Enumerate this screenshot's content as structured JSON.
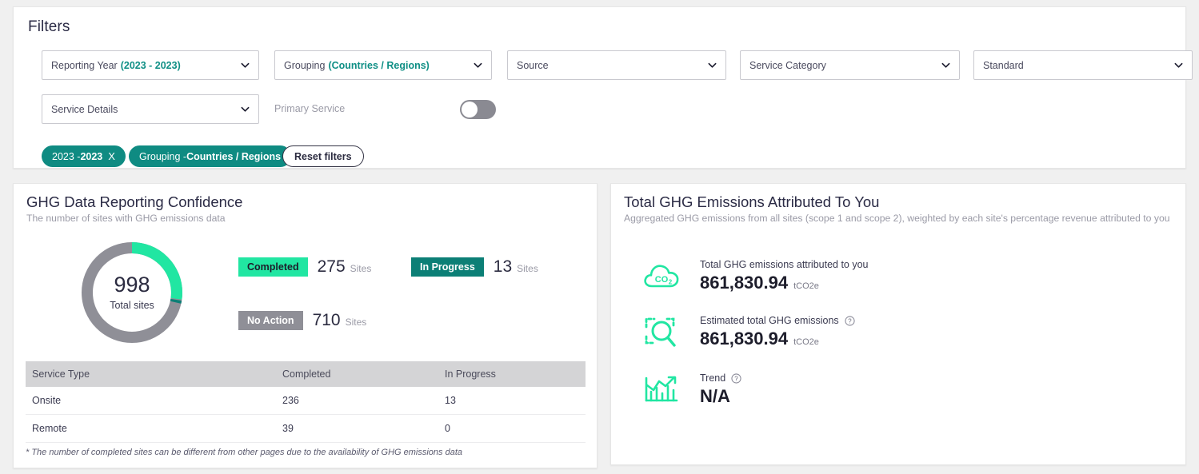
{
  "filters": {
    "title": "Filters",
    "selects": [
      {
        "label": "Reporting Year",
        "value": "(2023 - 2023)"
      },
      {
        "label": "Grouping",
        "value": "(Countries / Regions)"
      },
      {
        "label": "Source",
        "value": ""
      },
      {
        "label": "Service Category",
        "value": ""
      },
      {
        "label": "Standard",
        "value": ""
      },
      {
        "label": "Service Details",
        "value": ""
      }
    ],
    "primary_service_label": "Primary Service",
    "primary_service_on": false,
    "chips": [
      {
        "label": "2023  -  ",
        "strong": "2023",
        "close": "X"
      },
      {
        "label": "Grouping  -  ",
        "strong": "Countries / Regions",
        "close": ""
      }
    ],
    "reset_label": "Reset filters"
  },
  "confidence_panel": {
    "title": "GHG Data Reporting Confidence",
    "subtitle": "The number of sites with GHG emissions data",
    "donut": {
      "total": "998",
      "total_label": "Total sites"
    },
    "legend": [
      {
        "badge": "Completed",
        "count": "275",
        "unit": "Sites",
        "color": "#21e6a2"
      },
      {
        "badge": "In Progress",
        "count": "13",
        "unit": "Sites",
        "color": "#0c7f76"
      },
      {
        "badge": "No Action",
        "count": "710",
        "unit": "Sites",
        "color": "#8f8f97"
      }
    ],
    "table": {
      "headers": [
        "Service Type",
        "Completed",
        "In Progress"
      ],
      "rows": [
        [
          "Onsite",
          "236",
          "13"
        ],
        [
          "Remote",
          "39",
          "0"
        ]
      ]
    },
    "footnote": "* The number of completed sites can be different from other pages due to the availability of GHG emissions data"
  },
  "emissions_panel": {
    "title": "Total GHG Emissions Attributed To You",
    "subtitle": "Aggregated GHG emissions from all sites (scope 1 and scope 2), weighted by each site's percentage revenue attributed to you",
    "metrics": [
      {
        "label": "Total GHG emissions attributed to you",
        "value": "861,830.94",
        "unit": "tCO2e",
        "help": false
      },
      {
        "label": "Estimated total GHG emissions",
        "value": "861,830.94",
        "unit": "tCO2e",
        "help": true
      },
      {
        "label": "Trend",
        "value": "N/A",
        "unit": "",
        "help": true
      }
    ]
  },
  "chart_data": {
    "type": "pie",
    "title": "GHG Data Reporting Confidence",
    "categories": [
      "Completed",
      "In Progress",
      "No Action"
    ],
    "values": [
      275,
      13,
      710
    ],
    "total": 998,
    "colors": [
      "#21e6a2",
      "#0c7f76",
      "#8f8f97"
    ],
    "legend": "right",
    "unit": "Sites"
  }
}
